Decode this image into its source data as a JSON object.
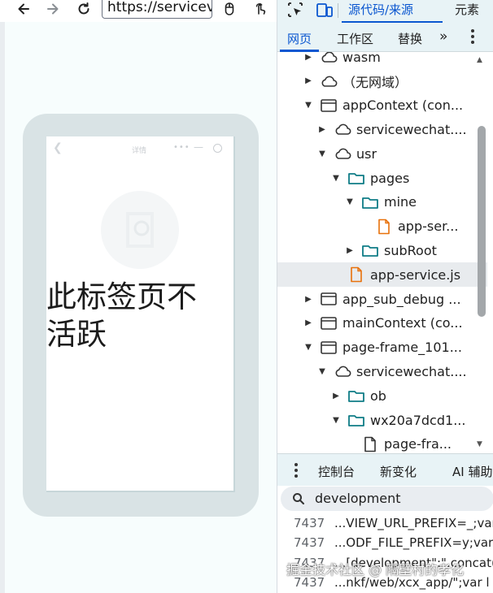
{
  "browser": {
    "url": "https://servicev",
    "icons": [
      "back-arrow-icon",
      "forward-arrow-icon",
      "reload-icon",
      "mouse-icon",
      "touch-icon"
    ]
  },
  "mini_program": {
    "header_title": "详情",
    "header_more": "•••",
    "header_min": "—",
    "inactive_text": "此标签页不活跃"
  },
  "devtools": {
    "main_tabs": [
      {
        "label": "源代码/来源",
        "active": true
      },
      {
        "label": "元素",
        "active": false
      }
    ],
    "source_tabs": [
      {
        "label": "网页",
        "active": true
      },
      {
        "label": "工作区",
        "active": false
      },
      {
        "label": "替换",
        "active": false
      },
      {
        "label": "»",
        "active": false
      }
    ],
    "tree": [
      {
        "label": "wasm",
        "icon": "cloud",
        "arrow": "right",
        "indent": 0
      },
      {
        "label": "（无网域）",
        "icon": "cloud",
        "arrow": "right",
        "indent": 0
      },
      {
        "label": "appContext (con...",
        "icon": "frame",
        "arrow": "down",
        "indent": 0
      },
      {
        "label": "servicewechat....",
        "icon": "cloud",
        "arrow": "right",
        "indent": 1
      },
      {
        "label": "usr",
        "icon": "cloud",
        "arrow": "down",
        "indent": 1
      },
      {
        "label": "pages",
        "icon": "folder",
        "arrow": "down",
        "indent": 2
      },
      {
        "label": "mine",
        "icon": "folder",
        "arrow": "down",
        "indent": 3
      },
      {
        "label": "app-ser...",
        "icon": "file-js",
        "arrow": "none",
        "indent": 4
      },
      {
        "label": "subRoot",
        "icon": "folder",
        "arrow": "right",
        "indent": 3
      },
      {
        "label": "app-service.js",
        "icon": "file-js",
        "arrow": "none",
        "indent": 2,
        "selected": true
      },
      {
        "label": "app_sub_debug ...",
        "icon": "frame",
        "arrow": "right",
        "indent": 0
      },
      {
        "label": "mainContext (co...",
        "icon": "frame",
        "arrow": "right",
        "indent": 0
      },
      {
        "label": "page-frame_101...",
        "icon": "frame",
        "arrow": "down",
        "indent": 0
      },
      {
        "label": "servicewechat....",
        "icon": "cloud",
        "arrow": "down",
        "indent": 1
      },
      {
        "label": "ob",
        "icon": "folder",
        "arrow": "right",
        "indent": 2
      },
      {
        "label": "wx20a7dcd1...",
        "icon": "folder",
        "arrow": "down",
        "indent": 2
      },
      {
        "label": "page-fra...",
        "icon": "file",
        "arrow": "none",
        "indent": 3
      }
    ],
    "console_tabs": [
      "控制台",
      "新变化",
      "AI 辅助"
    ],
    "search_query": "development",
    "results": [
      {
        "line": "7437",
        "text": "...VIEW_URL_PREFIX=_;var"
      },
      {
        "line": "7437",
        "text": "...ODF_FILE_PREFIX=y;var"
      },
      {
        "line": "7437",
        "text": "...[development\":\".concat("
      },
      {
        "line": "7437",
        "text": "...nkf/web/xcx_app/\";var l"
      }
    ]
  },
  "watermark": "掘金技术社区 @ 隔壁村的孝化"
}
